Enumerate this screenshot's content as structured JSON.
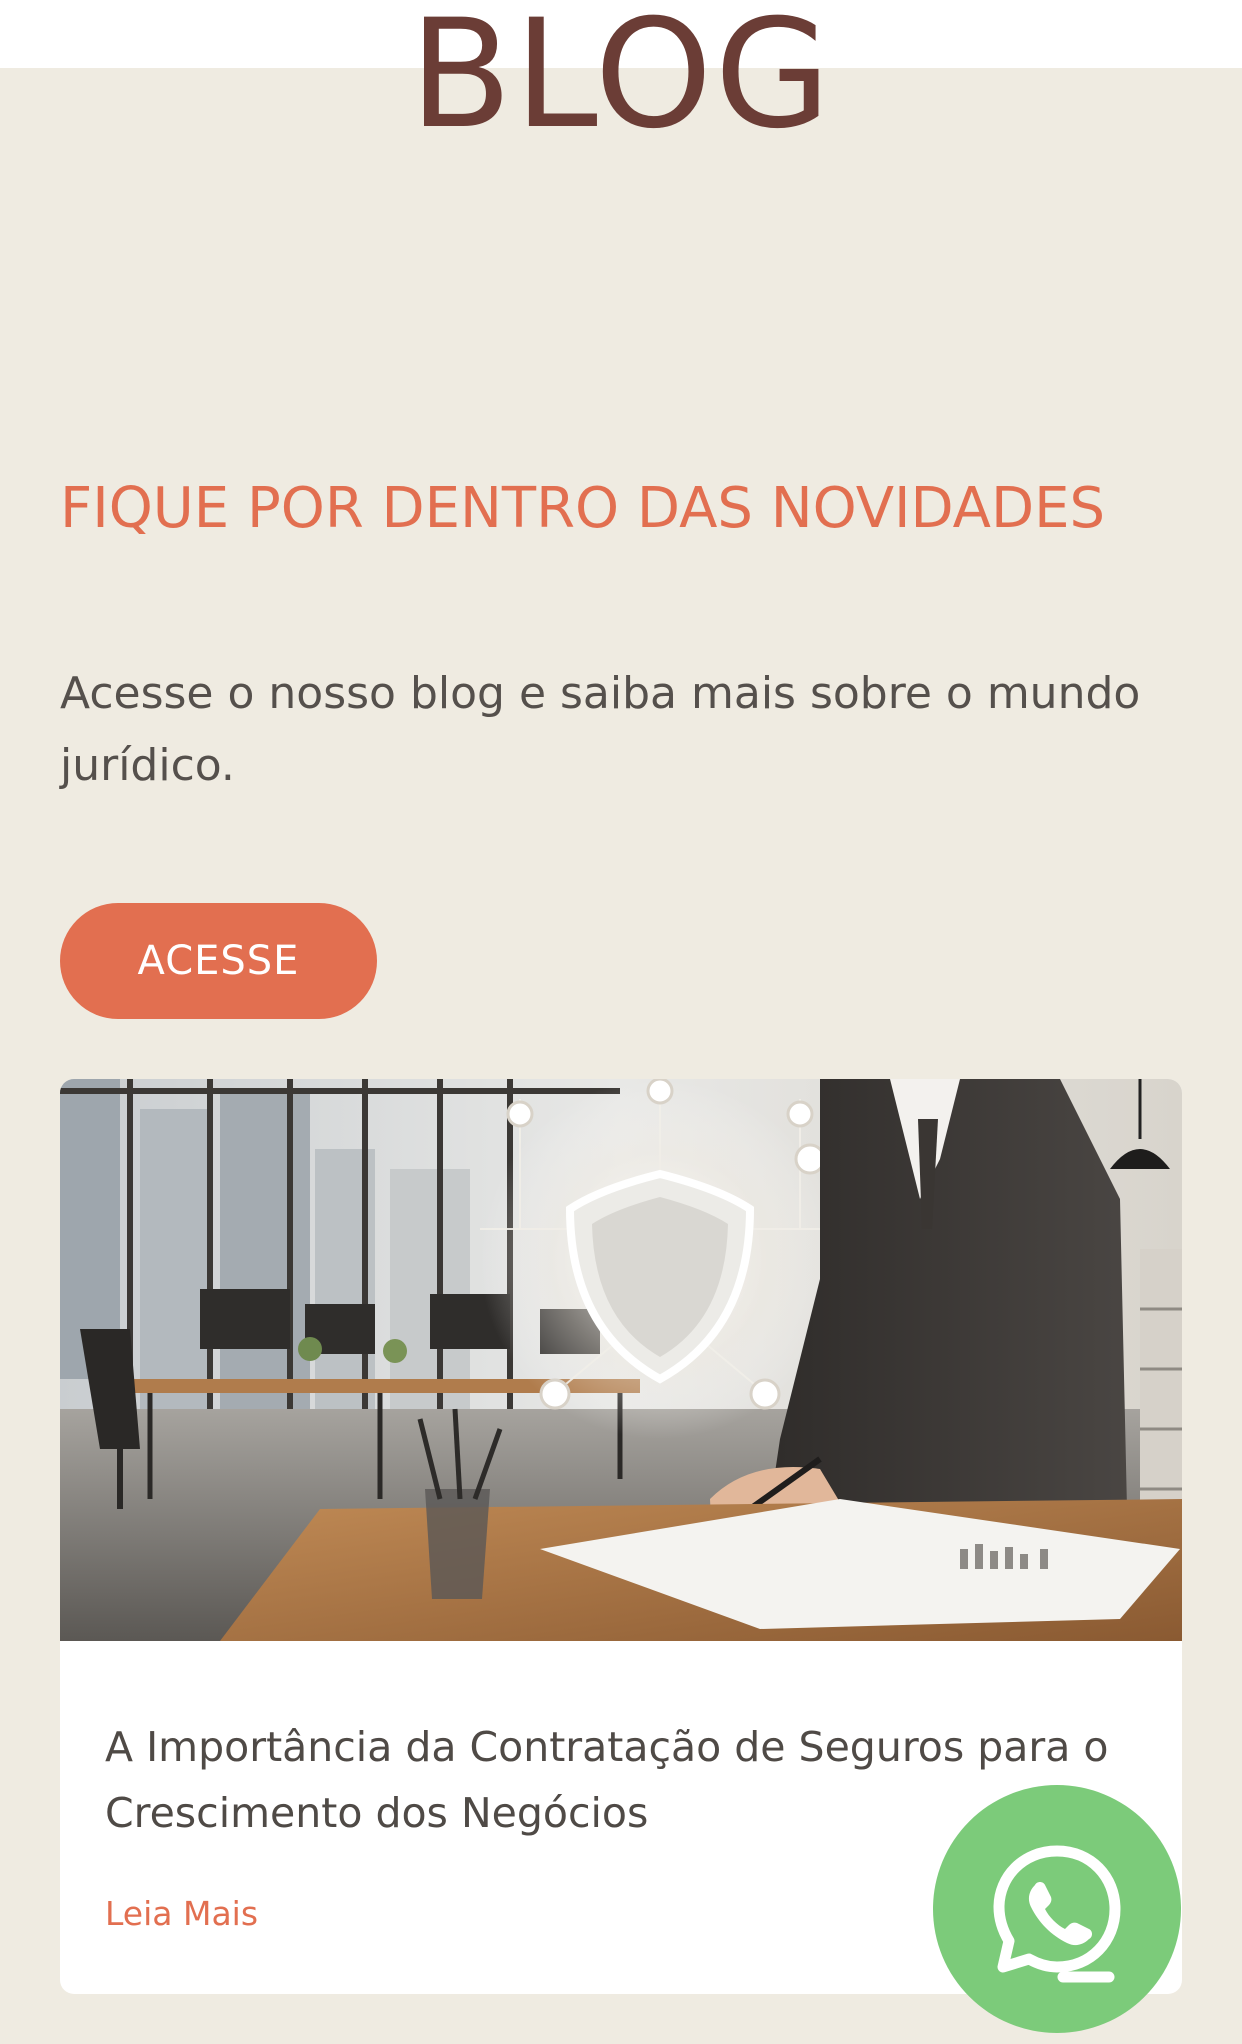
{
  "header": {
    "title": "BLOG"
  },
  "section": {
    "heading": "FIQUE POR DENTRO DAS NOVIDADES",
    "description": "Acesse o nosso blog e saiba mais sobre o mundo jurídico.",
    "cta_label": "ACESSE"
  },
  "post": {
    "image_icon": "office-shield-illustration",
    "title": "A Importância da Contratação de Seguros para o Crescimento dos Negócios",
    "read_more_label": "Leia Mais"
  },
  "floating": {
    "icon": "whatsapp-icon"
  },
  "colors": {
    "background": "#efebe1",
    "title": "#6b3d36",
    "accent": "#e26f50",
    "body_text": "#55504c",
    "whatsapp": "#7ccb7a"
  }
}
